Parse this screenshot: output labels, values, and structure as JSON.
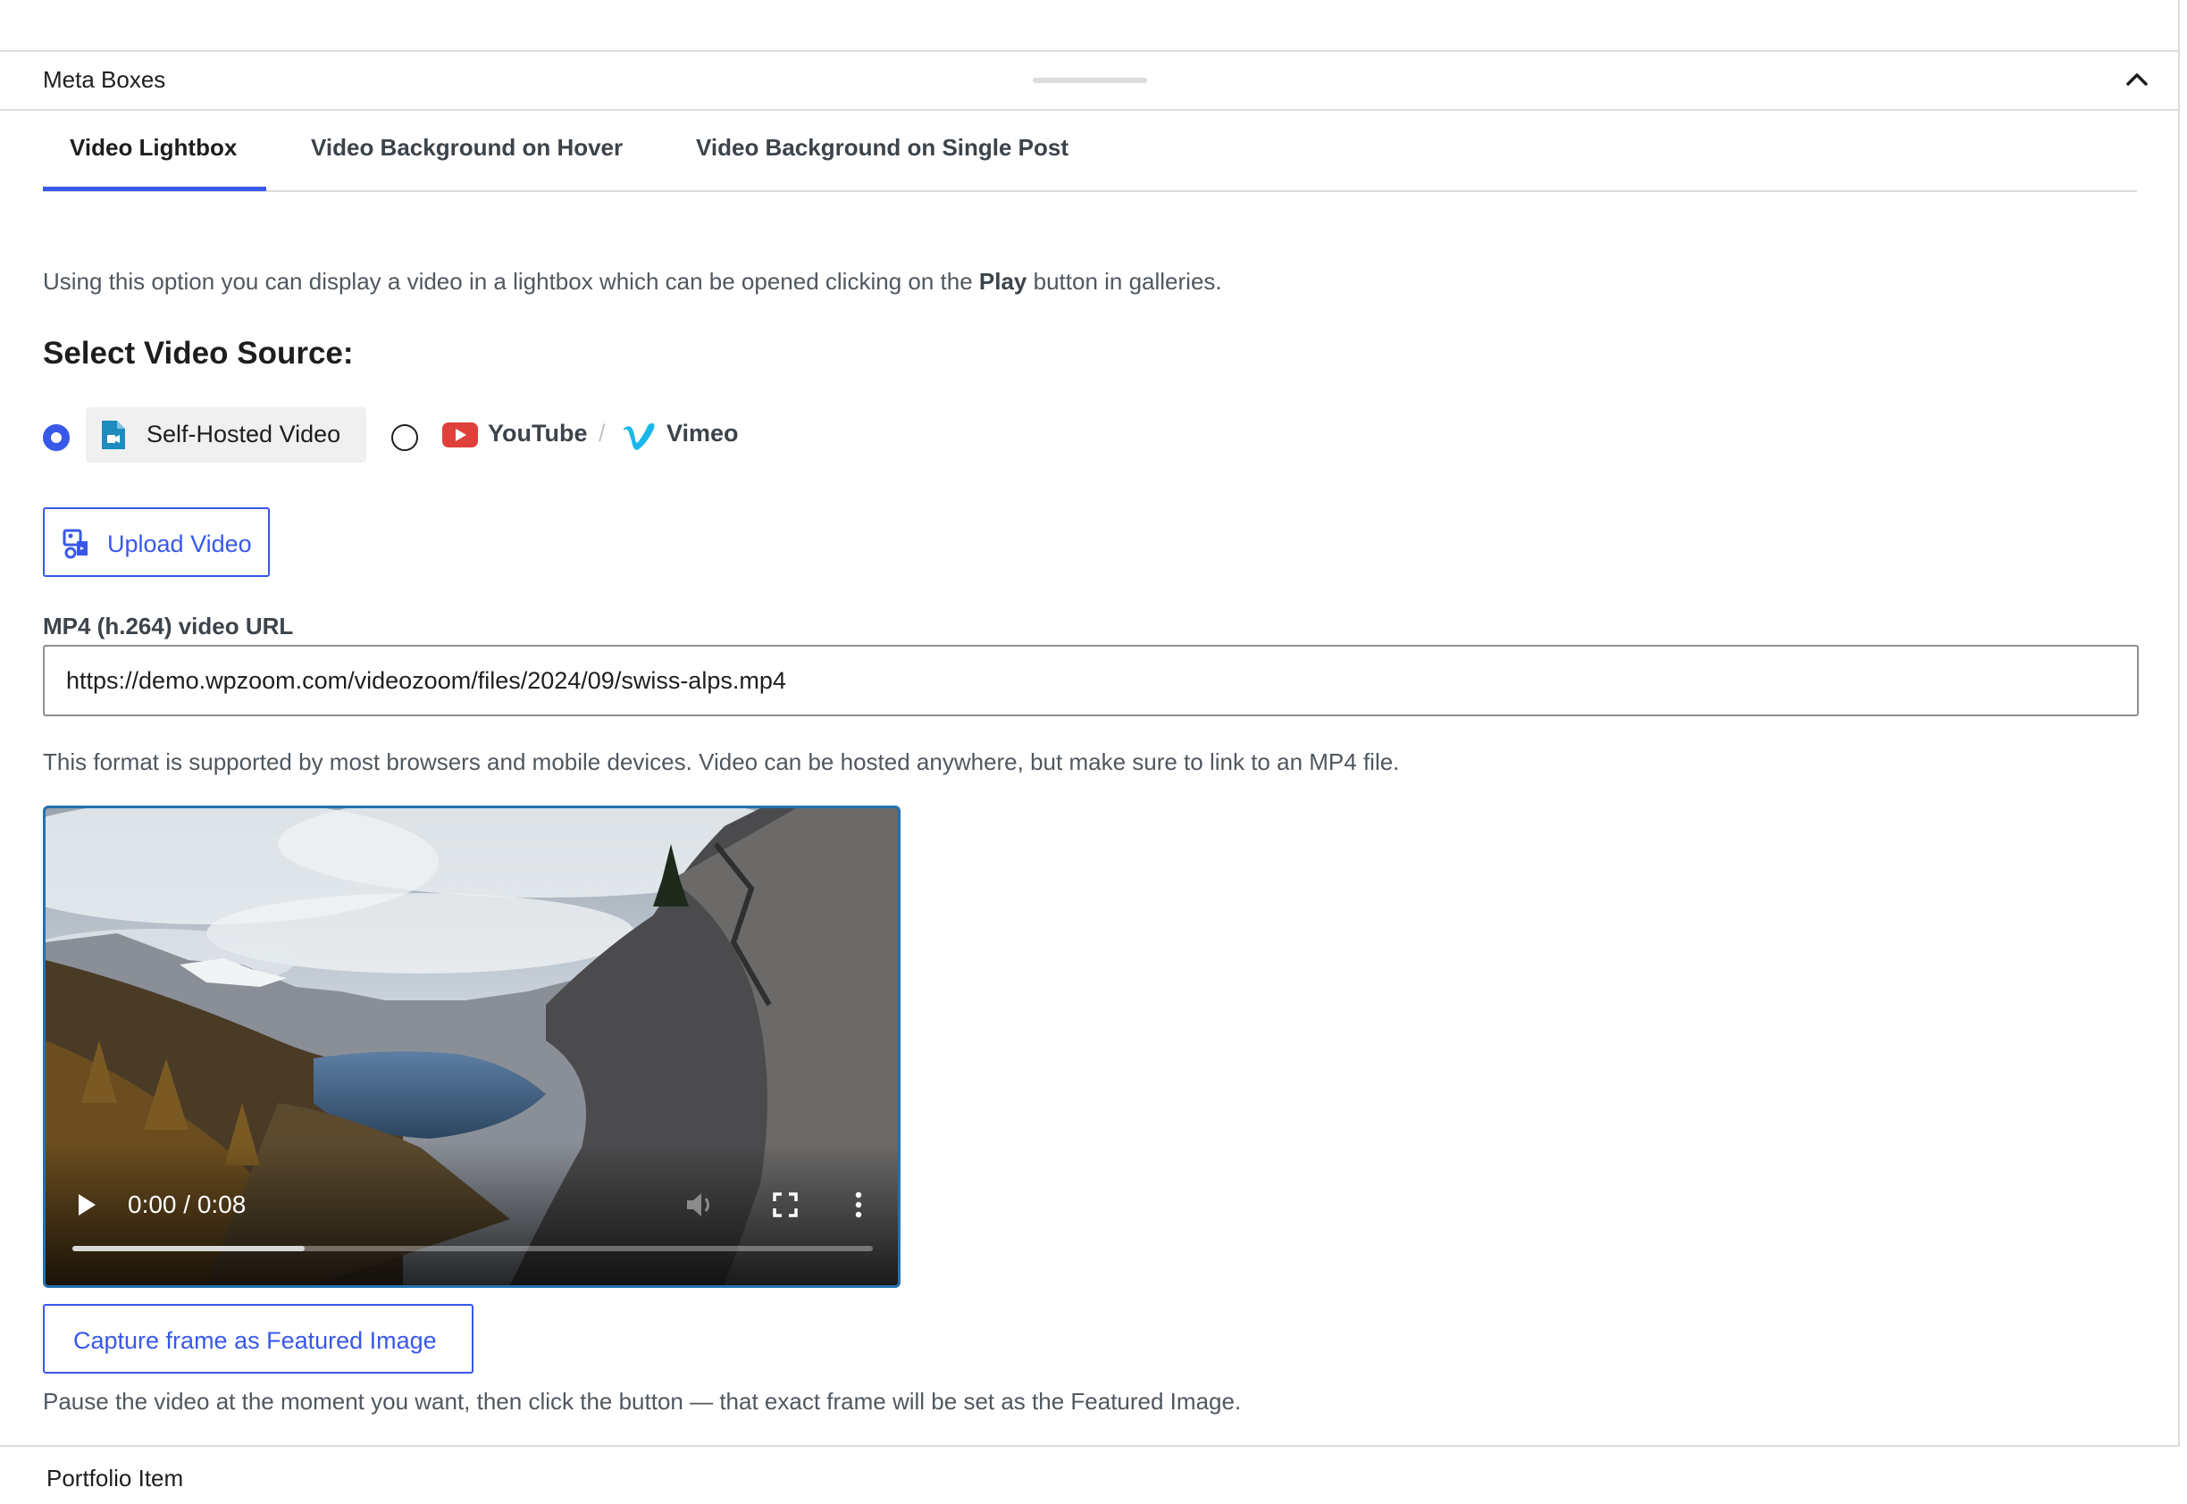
{
  "metabox": {
    "title": "Meta Boxes"
  },
  "tabs": [
    {
      "label": "Video Lightbox",
      "active": true
    },
    {
      "label": "Video Background on Hover",
      "active": false
    },
    {
      "label": "Video Background on Single Post",
      "active": false
    }
  ],
  "lightbox": {
    "description_before": "Using this option you can display a video in a lightbox which can be opened clicking on the ",
    "description_bold": "Play",
    "description_after": " button in galleries.",
    "source_heading": "Select Video Source:",
    "sources": {
      "self_hosted": {
        "label": "Self-Hosted Video",
        "selected": true,
        "icon": "video-file-icon"
      },
      "youtube": {
        "label": "YouTube",
        "selected": false,
        "icon": "youtube-icon"
      },
      "separator": "/",
      "vimeo": {
        "label": "Vimeo",
        "icon": "vimeo-icon"
      }
    },
    "upload_button": {
      "label": "Upload Video",
      "icon": "upload-media-icon"
    },
    "url_field": {
      "label": "MP4 (h.264) video URL",
      "value": "https://demo.wpzoom.com/videozoom/files/2024/09/swiss-alps.mp4"
    },
    "url_help": "This format is supported by most browsers and mobile devices. Video can be hosted anywhere, but make sure to link to an MP4 file.",
    "player": {
      "time": "0:00 / 0:08",
      "progress_fraction": 0.29,
      "icons": [
        "play-icon",
        "mute-icon",
        "fullscreen-icon",
        "more-options-icon"
      ]
    },
    "capture_button": {
      "label": "Capture frame as Featured Image"
    },
    "capture_help": "Pause the video at the moment you want, then click the button — that exact frame will be set as the Featured Image."
  },
  "footer": {
    "title": "Portfolio Item"
  },
  "colors": {
    "accent": "#3858e9",
    "youtube_red": "#e0403a",
    "vimeo_blue": "#1ab7ea",
    "file_icon_blue": "#1e8cbe",
    "border": "#dcdcde"
  }
}
